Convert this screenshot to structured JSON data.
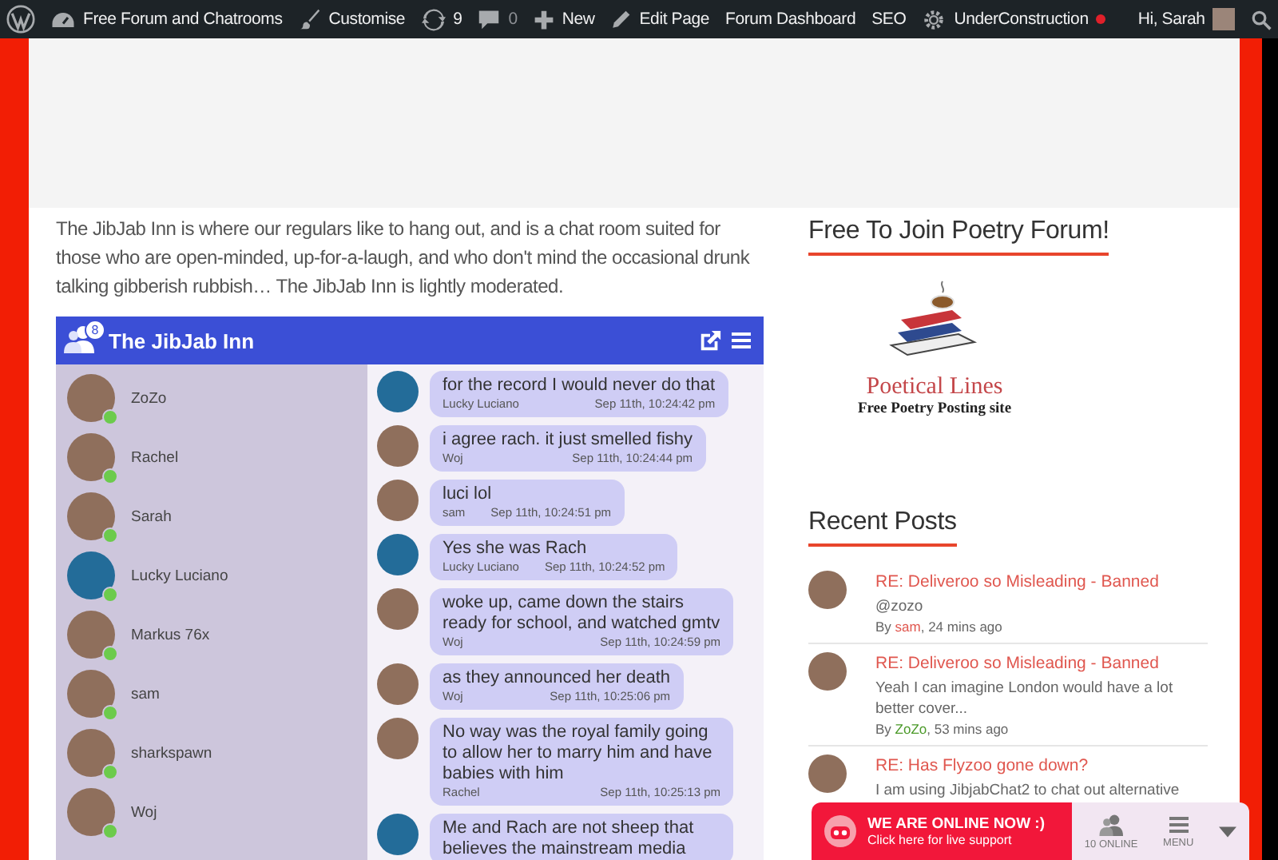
{
  "admin_bar": {
    "items": [
      {
        "kind": "dashboard",
        "label": "Free Forum and Chatrooms",
        "muted": false,
        "alert": false
      },
      {
        "kind": "brush",
        "label": "Customise",
        "muted": false,
        "alert": false
      },
      {
        "kind": "updates",
        "label": "9",
        "muted": false,
        "alert": false
      },
      {
        "kind": "comments",
        "label": "0",
        "muted": true,
        "alert": false
      },
      {
        "kind": "plus",
        "label": "New",
        "muted": false,
        "alert": false
      },
      {
        "kind": "pencil",
        "label": "Edit Page",
        "muted": false,
        "alert": false
      },
      {
        "kind": "text",
        "label": "Forum Dashboard",
        "muted": false,
        "alert": false
      },
      {
        "kind": "text",
        "label": "SEO",
        "muted": false,
        "alert": false
      },
      {
        "kind": "gear",
        "label": "UnderConstruction",
        "muted": false,
        "alert": true
      }
    ],
    "greeting": "Hi, Sarah"
  },
  "intro": "The JibJab Inn is where our regulars like to hang out, and is a chat room suited for those who are open-minded, up-for-a-laugh, and who don't mind the occasional drunk talking gibberish rubbish… The JibJab Inn is lightly moderated.",
  "chat": {
    "title": "The JibJab Inn",
    "online_count": "8",
    "users": [
      {
        "name": "ZoZo",
        "kind": "photo",
        "online": true
      },
      {
        "name": "Rachel",
        "kind": "photo",
        "online": true
      },
      {
        "name": "Sarah",
        "kind": "photo",
        "online": true
      },
      {
        "name": "Lucky Luciano",
        "kind": "default",
        "online": true
      },
      {
        "name": "Markus 76x",
        "kind": "photo",
        "online": true
      },
      {
        "name": "sam",
        "kind": "photo",
        "online": true
      },
      {
        "name": "sharkspawn",
        "kind": "photo",
        "online": true
      },
      {
        "name": "Woj",
        "kind": "photo",
        "online": true
      }
    ],
    "messages": [
      {
        "text": "for the record I would never do that",
        "author": "Lucky Luciano",
        "time": "Sep 11th, 10:24:42 pm",
        "kind": "default"
      },
      {
        "text": "i agree rach. it just smelled fishy",
        "author": "Woj",
        "time": "Sep 11th, 10:24:44 pm",
        "kind": "photo"
      },
      {
        "text": "luci lol",
        "author": "sam",
        "time": "Sep 11th, 10:24:51 pm",
        "kind": "photo"
      },
      {
        "text": "Yes she was Rach",
        "author": "Lucky Luciano",
        "time": "Sep 11th, 10:24:52 pm",
        "kind": "default"
      },
      {
        "text": "woke up, came down the stairs ready for school, and watched gmtv",
        "author": "Woj",
        "time": "Sep 11th, 10:24:59 pm",
        "kind": "photo"
      },
      {
        "text": "as they announced her death",
        "author": "Woj",
        "time": "Sep 11th, 10:25:06 pm",
        "kind": "photo"
      },
      {
        "text": "No way was the royal family going to allow her to marry him and have babies with him",
        "author": "Rachel",
        "time": "Sep 11th, 10:25:13 pm",
        "kind": "photo"
      },
      {
        "text": "Me and Rach are not sheep that believes the mainstream media",
        "kind": "default"
      }
    ]
  },
  "sidebar": {
    "widget_title": "Free To Join Poetry Forum!",
    "logo_title": "Poetical Lines",
    "logo_tagline": "Free Poetry Posting site",
    "recent_posts": {
      "title": "Recent Posts",
      "items": [
        {
          "title": "RE: Deliveroo so Misleading - Banned",
          "excerpt": "@zozo",
          "by": "By",
          "author": "sam",
          "time": ", 24 mins ago",
          "color": "#e0574f"
        },
        {
          "title": "RE: Deliveroo so Misleading - Banned",
          "excerpt": "Yeah I can imagine London would have a lot better cover...",
          "by": "By",
          "author": "ZoZo",
          "time": ", 53 mins ago",
          "color": "#4c9a2a"
        },
        {
          "title": "RE: Has Flyzoo gone down?",
          "excerpt": "I am using JibjabChat2 to chat out alternative"
        }
      ]
    }
  },
  "support": {
    "headline": "WE ARE ONLINE NOW :)",
    "subline": "Click here for live support",
    "online": "10 ONLINE",
    "menu": "MENU"
  }
}
